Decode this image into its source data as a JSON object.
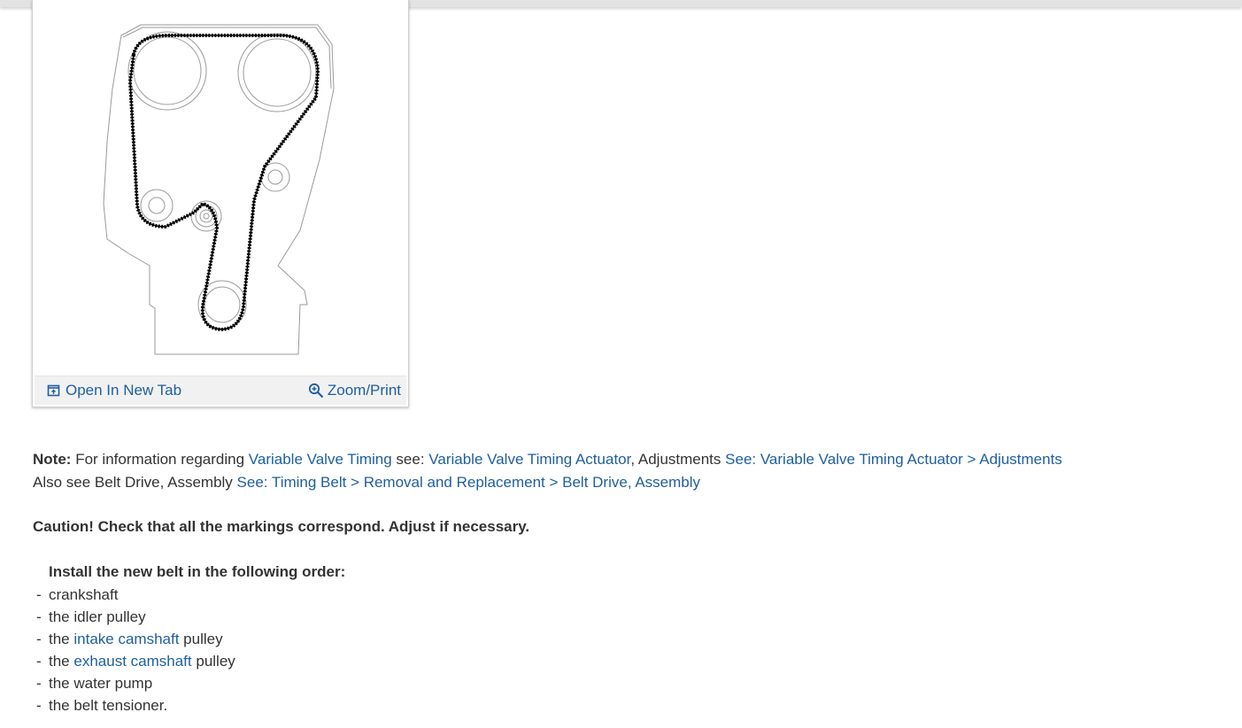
{
  "figure": {
    "open_tab_label": "Open In New Tab",
    "zoom_label": "Zoom/Print",
    "icons": {
      "open": "open-in-new-tab-icon",
      "zoom": "zoom-in-icon"
    }
  },
  "note": {
    "prefix": "Note:",
    "text1": "For information regarding",
    "link1": "Variable Valve Timing",
    "text2": "see:",
    "link2": "Variable Valve Timing Actuator",
    "text3": ", Adjustments",
    "link3": "See: Variable Valve Timing Actuator > Adjustments"
  },
  "also_see": {
    "text": "Also see Belt Drive, Assembly",
    "link": "See: Timing Belt > Removal and Replacement > Belt Drive, Assembly"
  },
  "caution": "Caution! Check that all the markings correspond. Adjust if necessary.",
  "install": {
    "heading": "Install the new belt in the following order:",
    "items": [
      {
        "dash": "-",
        "text": "crankshaft"
      },
      {
        "dash": "-",
        "text": "the idler pulley"
      },
      {
        "dash": "-",
        "pre": "the",
        "link": "intake camshaft",
        "post": "pulley"
      },
      {
        "dash": "-",
        "pre": "the",
        "link": "exhaust camshaft",
        "post": "pulley"
      },
      {
        "dash": "-",
        "text": "the water pump"
      },
      {
        "dash": "-",
        "text": "the belt tensioner."
      }
    ]
  },
  "colors": {
    "link": "#1f5f9e",
    "text": "#333333",
    "footer_bg": "#f1f1f1"
  }
}
